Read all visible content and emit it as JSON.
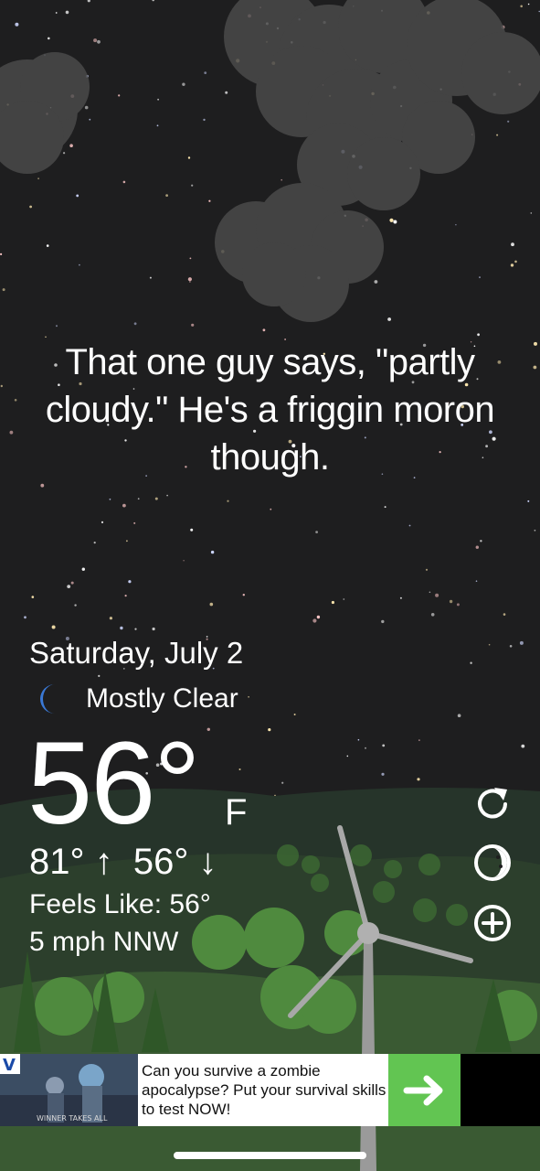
{
  "headline": "That one guy says, \"partly cloudy.\" He's a friggin moron though.",
  "weather": {
    "date": "Saturday, July 2",
    "condition": "Mostly Clear",
    "condition_icon": "crescent-moon-icon",
    "temperature": "56°",
    "unit": "F",
    "high_low": "81° ↑  56° ↓",
    "feels_like": "Feels Like: 56°",
    "wind": "5 mph NNW"
  },
  "side_buttons": [
    "refresh-icon",
    "theme-icon",
    "add-icon"
  ],
  "ad": {
    "logo_text": "V",
    "image_caption": "WINNER TAKES ALL",
    "text": "Can you survive a zombie apocalypse? Put your survival skills to test NOW!",
    "cta_icon": "arrow-right-icon"
  },
  "colors": {
    "sky": "#1e1e1f",
    "hills": "#2f4a2e",
    "ad_green": "#62c552",
    "moon": "#3a78d4"
  }
}
